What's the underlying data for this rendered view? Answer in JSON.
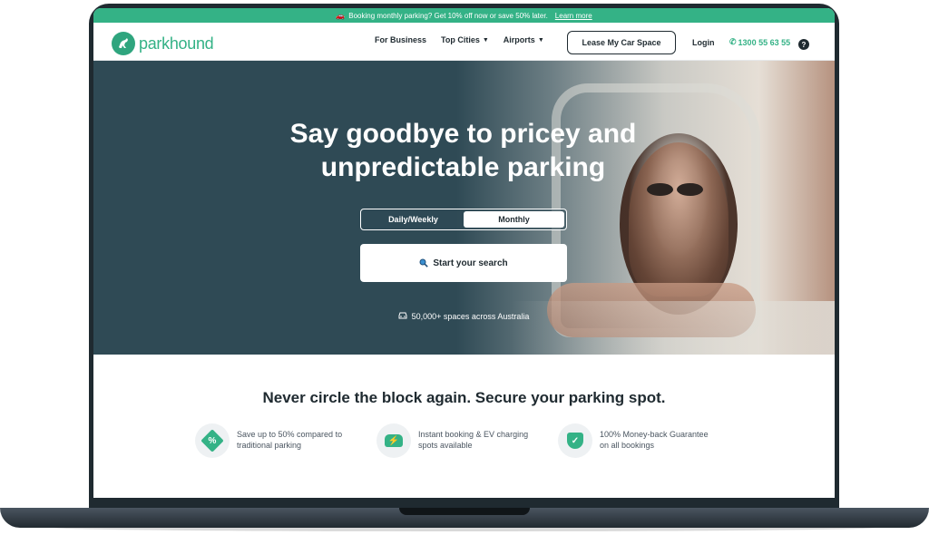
{
  "announcement": {
    "text": "Booking monthly parking? Get 10% off now or save 50% later.",
    "link": "Learn more"
  },
  "header": {
    "logo_text": "parkhound",
    "nav": [
      {
        "label": "For Business"
      },
      {
        "label": "Top Cities"
      },
      {
        "label": "Airports"
      }
    ],
    "lease_button": "Lease My Car Space",
    "login": "Login",
    "phone": "1300 55 63 55",
    "help_glyph": "?"
  },
  "hero": {
    "title": "Say goodbye to pricey and unpredictable parking",
    "toggle": {
      "daily": "Daily/Weekly",
      "monthly": "Monthly",
      "selected": "Monthly"
    },
    "search_button": "Start your search",
    "spaces_text": "50,000+ spaces across Australia"
  },
  "lower": {
    "tagline": "Never circle the block again. Secure your parking spot.",
    "features": [
      {
        "icon": "discount-tag-icon",
        "text": "Save up to 50% compared to traditional parking"
      },
      {
        "icon": "ev-car-icon",
        "text": "Instant booking & EV charging spots available"
      },
      {
        "icon": "shield-check-icon",
        "text": "100% Money-back Guarantee on all bookings"
      }
    ]
  },
  "colors": {
    "brand_green": "#34b286",
    "dark_navy": "#1f2a30",
    "hero_teal": "#2f4a55"
  }
}
